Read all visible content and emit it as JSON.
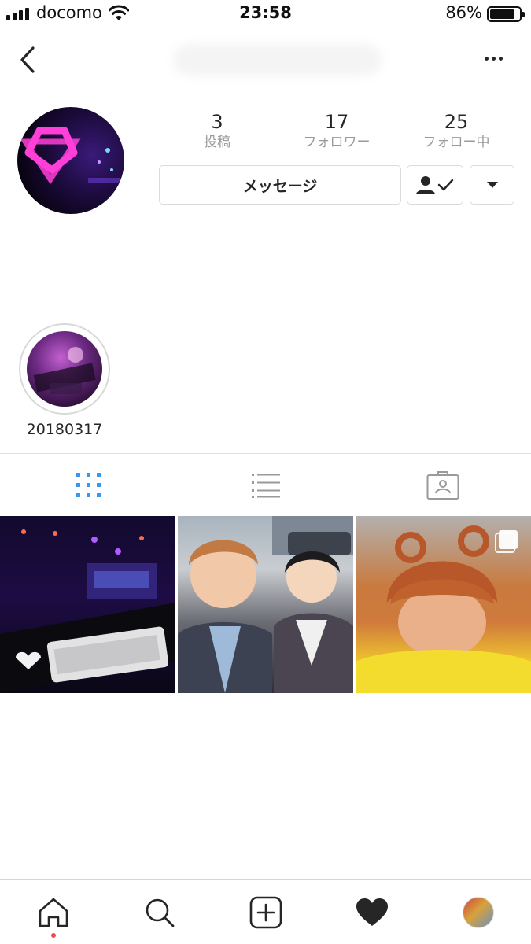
{
  "status_bar": {
    "carrier": "docomo",
    "time": "23:58",
    "battery_percent": "86%",
    "battery_level": 0.86
  },
  "nav": {
    "back_icon": "chevron-left-icon",
    "more_icon": "ellipsis-icon"
  },
  "profile": {
    "stats": [
      {
        "value": "3",
        "label": "投稿"
      },
      {
        "value": "17",
        "label": "フォロワー"
      },
      {
        "value": "25",
        "label": "フォロー中"
      }
    ],
    "message_button": "メッセージ",
    "following_icon": "user-check-icon",
    "dropdown_icon": "triangle-down-icon"
  },
  "highlights": [
    {
      "label": "20180317"
    }
  ],
  "tabs": [
    {
      "name": "grid",
      "icon": "grid-icon",
      "active": true
    },
    {
      "name": "list",
      "icon": "list-icon",
      "active": false
    },
    {
      "name": "tagged",
      "icon": "tagged-icon",
      "active": false
    }
  ],
  "posts": [
    {
      "type": "photo"
    },
    {
      "type": "photo"
    },
    {
      "type": "carousel"
    }
  ],
  "bottom_nav": [
    {
      "name": "home",
      "icon": "home-icon"
    },
    {
      "name": "search",
      "icon": "search-icon"
    },
    {
      "name": "new-post",
      "icon": "plus-square-icon"
    },
    {
      "name": "activity",
      "icon": "heart-icon"
    },
    {
      "name": "profile",
      "icon": "avatar-icon"
    }
  ],
  "colors": {
    "active_tab": "#3897f0",
    "notification_dot": "#ed4956",
    "border": "#dbdbdb",
    "secondary_text": "#9a9a9a"
  }
}
